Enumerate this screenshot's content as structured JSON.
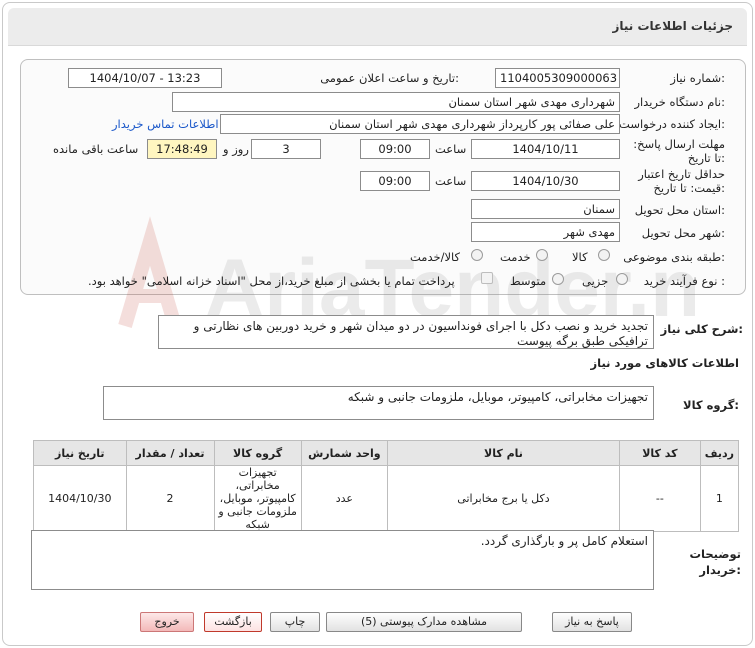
{
  "header": {
    "title": "جزئیات اطلاعات نیاز"
  },
  "form": {
    "need_number_label": "شماره نیاز:",
    "need_number": "1104005309000063",
    "announce_label": "تاریخ و ساعت اعلان عمومی:",
    "announce_value": "1404/10/07 - 13:23",
    "buyer_org_label": "نام دستگاه خریدار:",
    "buyer_org": "شهرداری مهدی شهر استان سمنان",
    "creator_label": "ایجاد کننده درخواست:",
    "creator": "علی صفائی پور کارپرداز شهرداری مهدی شهر استان سمنان",
    "contact_link": "اطلاعات تماس خریدار",
    "reply_deadline_label": "مهلت ارسال پاسخ: تا تاریخ:",
    "reply_date": "1404/10/11",
    "time_label": "ساعت",
    "reply_time": "09:00",
    "days_value": "3",
    "days_and_label": "روز و",
    "remaining_time": "17:48:49",
    "remaining_label": "ساعت باقی مانده",
    "validity_label": "حداقل تاریخ اعتبار قیمت: تا تاریخ:",
    "validity_date": "1404/10/30",
    "validity_time": "09:00",
    "province_label": "استان محل تحویل:",
    "province": "سمنان",
    "city_label": "شهر محل تحویل:",
    "city": "مهدی شهر",
    "category_label": "طبقه بندی موضوعی:",
    "category_options": [
      "کالا",
      "خدمت",
      "کالا/خدمت"
    ],
    "process_label": "نوع فرآیند خرید :",
    "process_options": [
      "جزیی",
      "متوسط"
    ],
    "payment_note": "پرداخت تمام یا بخشی از مبلغ خرید،از محل \"اسناد خزانه اسلامی\" خواهد بود."
  },
  "summary": {
    "label": "شرح کلی نیاز:",
    "text": "تجدید خرید و نصب دکل با اجرای فونداسیون در دو میدان شهر و خرید دوربین های نظارتی و ترافیکی طبق برگه پیوست"
  },
  "goods": {
    "section_title": "اطلاعات کالاهای مورد نیاز",
    "group_label": "گروه کالا:",
    "group_value": "تجهیزات مخابراتی، کامپیوتر، موبایل، ملزومات جانبی و شبکه"
  },
  "table": {
    "headers": [
      "ردیف",
      "کد کالا",
      "نام کالا",
      "واحد شمارش",
      "گروه کالا",
      "تعداد / مقدار",
      "تاریخ نیاز"
    ],
    "rows": [
      {
        "row": "1",
        "code": "--",
        "name": "دکل یا برج مخابراتی",
        "unit": "عدد",
        "group": "تجهیزات مخابراتی، کامپیوتر، موبایل، ملزومات جانبی و شبکه",
        "qty": "2",
        "date": "1404/10/30"
      }
    ]
  },
  "buyer_notes": {
    "label": "توضیحات خریدار:",
    "text": "استعلام کامل پر و بارگذاری گردد."
  },
  "buttons": {
    "reply": "پاسخ به نیاز",
    "attachments": "مشاهده مدارک پیوستی (5)",
    "print": "چاپ",
    "back": "بازگشت",
    "exit": "خروج"
  },
  "watermark": {
    "text": "AriaTender.neT"
  },
  "colors": {
    "link": "#1a57c9",
    "remaining_bg": "#fff6c0",
    "header_bg": "#ececec"
  }
}
